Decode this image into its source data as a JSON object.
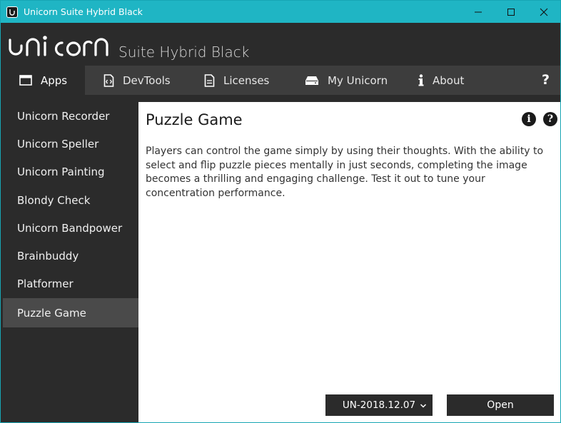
{
  "window": {
    "title": "Unicorn Suite Hybrid Black"
  },
  "brand": {
    "logo_text": "unicorn",
    "product": "Suite Hybrid Black"
  },
  "tabs": [
    {
      "label": "Apps",
      "icon": "window-icon",
      "active": true
    },
    {
      "label": "DevTools",
      "icon": "code-file-icon",
      "active": false
    },
    {
      "label": "Licenses",
      "icon": "document-icon",
      "active": false
    },
    {
      "label": "My Unicorn",
      "icon": "device-icon",
      "active": false
    },
    {
      "label": "About",
      "icon": "info-icon",
      "active": false
    }
  ],
  "help_label": "?",
  "sidebar": {
    "items": [
      {
        "label": "Unicorn Recorder"
      },
      {
        "label": "Unicorn Speller"
      },
      {
        "label": "Unicorn Painting"
      },
      {
        "label": "Blondy Check"
      },
      {
        "label": "Unicorn Bandpower"
      },
      {
        "label": "Brainbuddy"
      },
      {
        "label": "Platformer"
      },
      {
        "label": "Puzzle Game"
      }
    ],
    "selected": "Puzzle Game"
  },
  "main": {
    "title": "Puzzle Game",
    "description": "Players can control the game simply by using their thoughts. With the ability to select and flip puzzle pieces mentally in just seconds, completing the image becomes a thrilling and engaging challenge. Test it out to tune your concentration performance.",
    "info_icon_label": "i",
    "help_icon_label": "?",
    "version": "UN-2018.12.07",
    "open_label": "Open"
  },
  "colors": {
    "titlebar": "#1fb5c4",
    "dark": "#2b2b2b",
    "tabbar": "#3d3d3d",
    "selected": "#4a4a4a"
  }
}
